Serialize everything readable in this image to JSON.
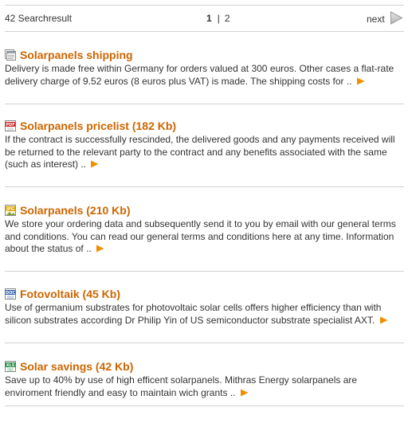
{
  "pager": {
    "count_label": "42 Searchresult",
    "current_page": "1",
    "separator": "|",
    "other_page": "2",
    "next_label": "next"
  },
  "colors": {
    "title": "#cc6600",
    "arrow": "#f09000",
    "divider": "#d2d2d2"
  },
  "results": [
    {
      "icon": "web-page-icon",
      "title": "Solarpanels shipping",
      "text": "Delivery is made free within Germany for orders valued at 300 euros. Other cases a flat-rate delivery charge of 9.52 euros (8 euros plus VAT) is made. The shipping costs for .."
    },
    {
      "icon": "pdf-file-icon",
      "icon_label": "PDF",
      "title": "Solarpanels pricelist (182 Kb)",
      "text": "If the contract is successfully rescinded, the delivered goods and any payments received will be returned to the relevant party to the contract and any benefits associated with the same (such as interest) .."
    },
    {
      "icon": "jpg-file-icon",
      "icon_label": "JPG",
      "title": "Solarpanels (210 Kb)",
      "text": "We store your ordering data and subsequently send it to you by email with our general terms and conditions. You can read our general terms and conditions here at any time. Information about the status of .."
    },
    {
      "icon": "doc-file-icon",
      "icon_label": "DOC",
      "title": "Fotovoltaik (45 Kb)",
      "text": "Use of germanium substrates for photovoltaic solar cells offers higher efficiency than with silicon substrates according Dr Philip Yin of US semiconductor substrate specialist AXT."
    },
    {
      "icon": "xls-file-icon",
      "icon_label": "XLS",
      "title": "Solar savings (42 Kb)",
      "text": "Save up to 40% by use of high efficent solarpanels. Mithras Energy solarpanels are enviroment friendly and easy to maintain wich grants .."
    }
  ]
}
